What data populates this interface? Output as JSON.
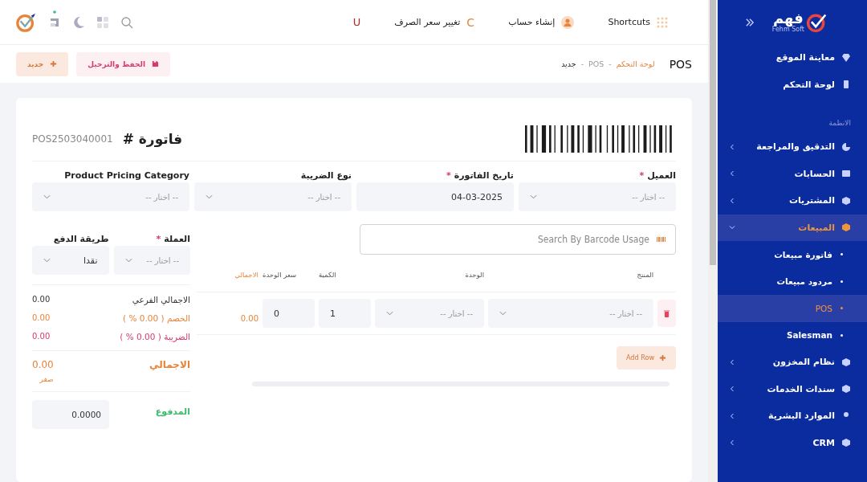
{
  "sidebar": {
    "logo_text": "فهم",
    "logo_subtext": "Fehm Soft",
    "items": [
      {
        "kind": "link",
        "label": "معاينة الموقع"
      },
      {
        "kind": "link",
        "label": "لوحة التحكم"
      },
      {
        "kind": "heading",
        "label": "الانظمة"
      },
      {
        "kind": "group",
        "label": "التدقيق والمراجعة",
        "expanded": false
      },
      {
        "kind": "group",
        "label": "الحسابات",
        "expanded": false
      },
      {
        "kind": "group",
        "label": "المشتريات",
        "expanded": false
      },
      {
        "kind": "group",
        "label": "المبيعات",
        "expanded": true,
        "children": [
          {
            "label": "فاتورة مبيعات",
            "selected": false
          },
          {
            "label": "مردود مبيعات",
            "selected": false
          },
          {
            "label": "POS",
            "selected": true
          },
          {
            "label": "Salesman",
            "selected": false
          }
        ]
      },
      {
        "kind": "group",
        "label": "نظام المخزون",
        "expanded": false
      },
      {
        "kind": "group",
        "label": "سندات الخدمات",
        "expanded": false
      },
      {
        "kind": "group",
        "label": "الموارد البشرية",
        "expanded": false
      },
      {
        "kind": "group",
        "label": "CRM",
        "expanded": false
      }
    ]
  },
  "topbar": {
    "shortcuts": "Shortcuts",
    "account": "إنشاء حساب",
    "exchange_mark": "C",
    "exchange": "تغيير سعر الصرف",
    "u_mark": "U"
  },
  "page": {
    "title": "POS",
    "breadcrumb": [
      {
        "kind": "home",
        "text": "لوحة التحكم"
      },
      {
        "kind": "sep",
        "text": "-"
      },
      {
        "kind": "parent",
        "text": "POS"
      },
      {
        "kind": "sep",
        "text": "-"
      },
      {
        "kind": "current",
        "text": "جديد"
      }
    ],
    "save_button": "الحفظ والترحيل",
    "new_button": "جديد"
  },
  "invoice": {
    "title": "فاتورة #",
    "number": "POS2503040001",
    "fields": [
      {
        "kind": "select",
        "label": "العميل",
        "mark": "*",
        "placeholder": "-- اختار --"
      },
      {
        "kind": "date",
        "label": "تاريخ الفاتورة",
        "mark": "*",
        "value": "04-03-2025"
      },
      {
        "kind": "select",
        "label": "نوع الضريبة",
        "placeholder": "-- اختار --"
      },
      {
        "kind": "select",
        "label": "Product Pricing Category",
        "placeholder": "-- اختار --"
      }
    ],
    "search": {
      "placeholder": "Search By Barcode Usage"
    },
    "table": {
      "columns": [
        "المنتج",
        "الوحدة",
        "الكمية",
        "سعر الوحدة",
        "الاجمالي"
      ],
      "rows": [
        {
          "product": "-- اختار --",
          "unit": "-- اختار --",
          "quantity": "1",
          "price": "0",
          "total": "0.00"
        }
      ],
      "add_row": "Add Row"
    },
    "payment": {
      "currency_label": "العملة",
      "currency_mark": "*",
      "currency_placeholder": "-- اختار --",
      "method_label": "طريقة الدفع",
      "method_value": "نقدا"
    },
    "totals": [
      {
        "kind": "subtotal",
        "label": "الاجمالي الفرعي",
        "value": "0.00"
      },
      {
        "kind": "discount",
        "label": "الخصم ( 0.00 % )",
        "value": "0.00"
      },
      {
        "kind": "tax",
        "label": "الضريبة ( 0.00 % )",
        "value": "0.00"
      }
    ],
    "grand": {
      "label": "الاجمالي",
      "value": "0.00",
      "words": "صفر"
    },
    "paid": {
      "label": "المدفوع",
      "value": "0.0000"
    }
  }
}
